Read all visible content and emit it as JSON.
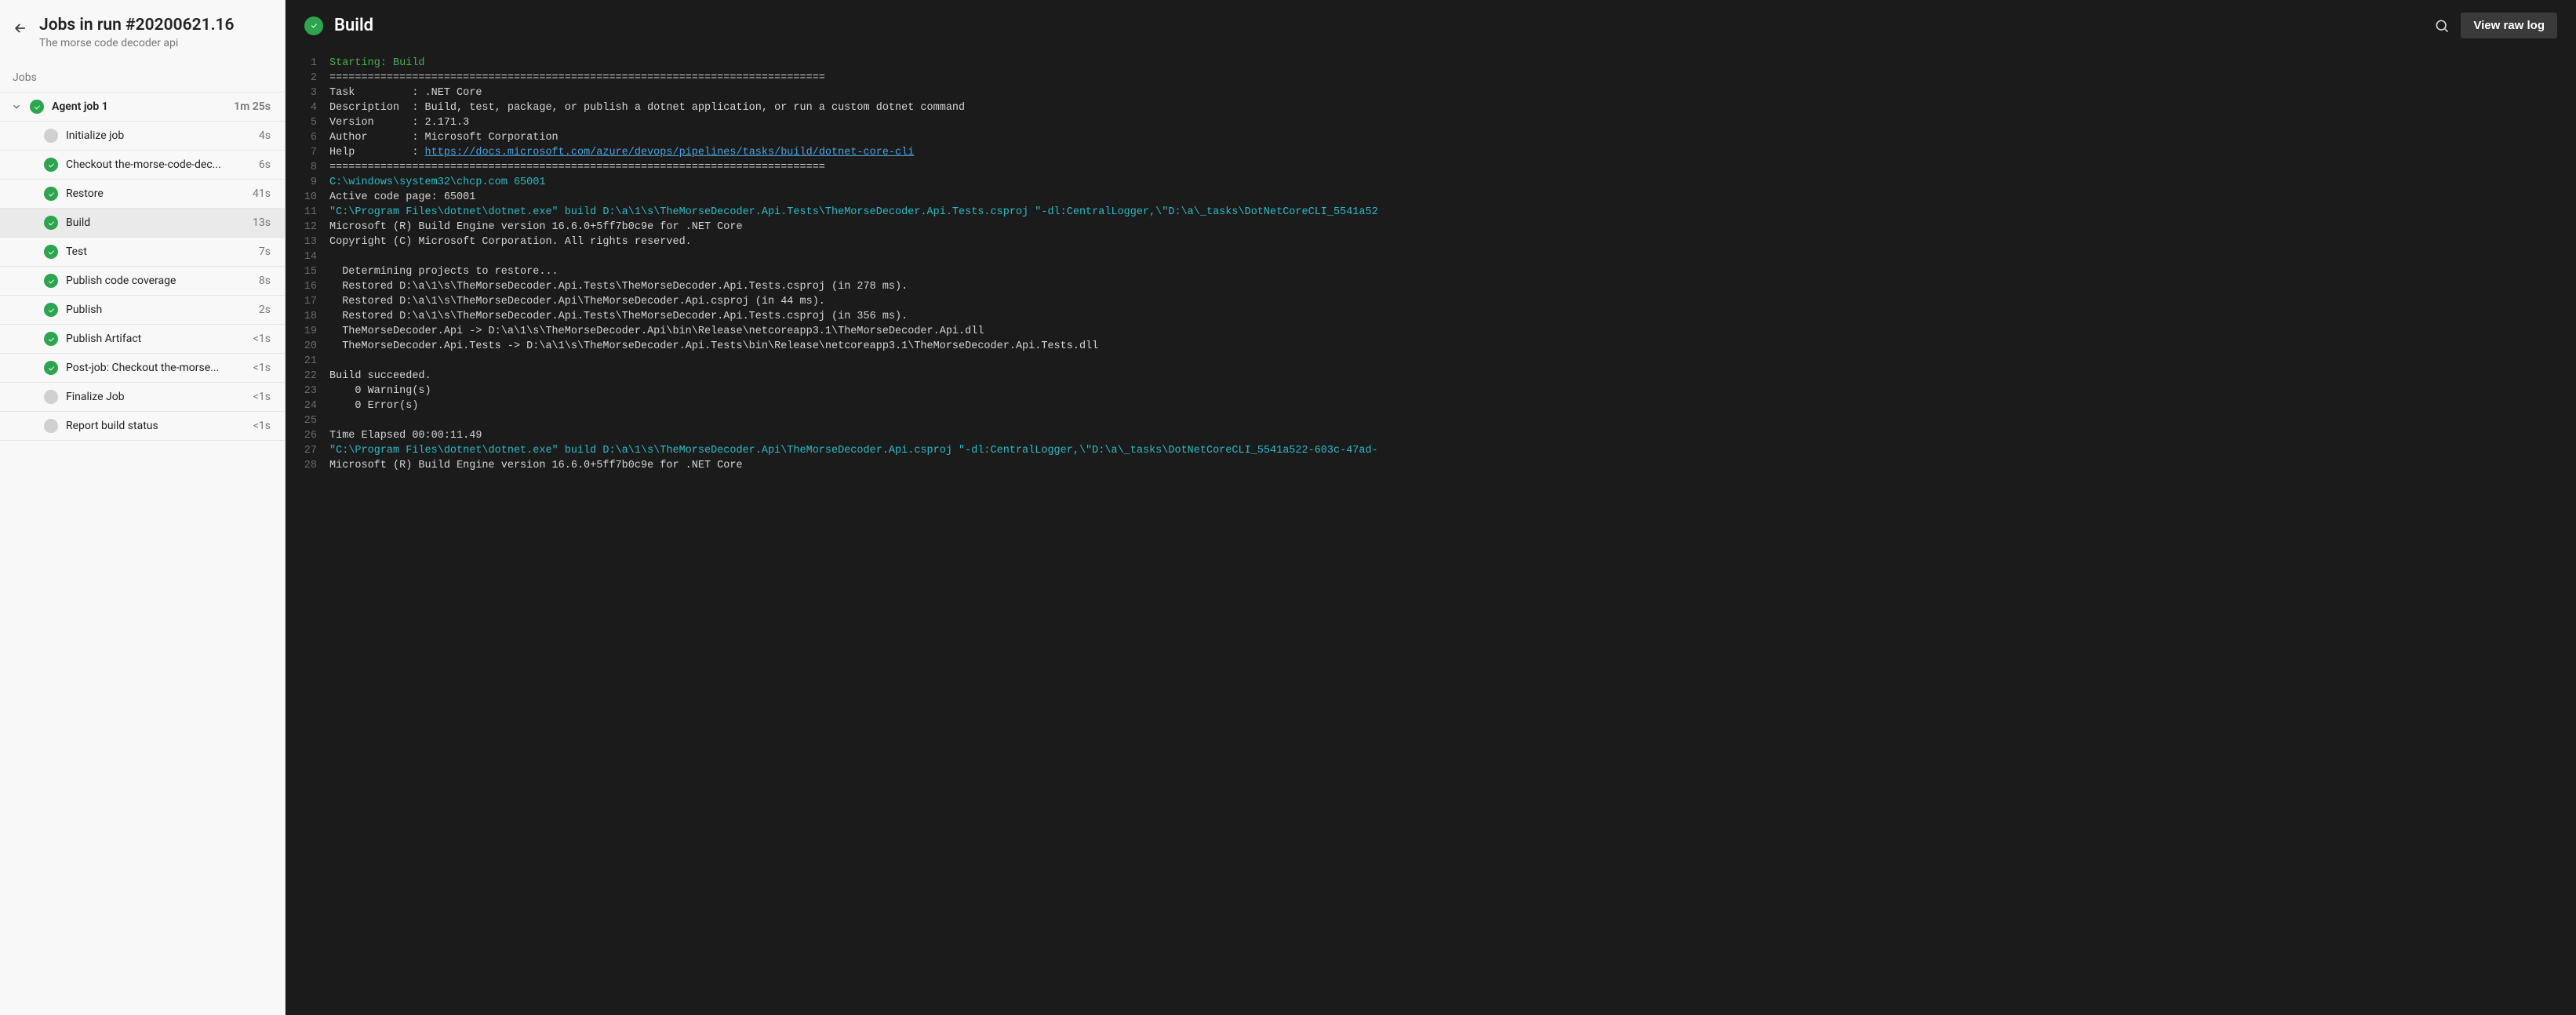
{
  "sidebar": {
    "title": "Jobs in run #20200621.16",
    "subtitle": "The morse code decoder api",
    "jobs_heading": "Jobs",
    "parent": {
      "label": "Agent job 1",
      "time": "1m 25s"
    },
    "steps": [
      {
        "label": "Initialize job",
        "time": "4s",
        "status": "neutral"
      },
      {
        "label": "Checkout the-morse-code-dec...",
        "time": "6s",
        "status": "success"
      },
      {
        "label": "Restore",
        "time": "41s",
        "status": "success"
      },
      {
        "label": "Build",
        "time": "13s",
        "status": "success",
        "selected": true
      },
      {
        "label": "Test",
        "time": "7s",
        "status": "success"
      },
      {
        "label": "Publish code coverage",
        "time": "8s",
        "status": "success"
      },
      {
        "label": "Publish",
        "time": "2s",
        "status": "success"
      },
      {
        "label": "Publish Artifact",
        "time": "<1s",
        "status": "success"
      },
      {
        "label": "Post-job: Checkout the-morse...",
        "time": "<1s",
        "status": "success"
      },
      {
        "label": "Finalize Job",
        "time": "<1s",
        "status": "neutral"
      },
      {
        "label": "Report build status",
        "time": "<1s",
        "status": "neutral"
      }
    ]
  },
  "header": {
    "title": "Build",
    "raw_log_button": "View raw log"
  },
  "log_lines": [
    {
      "n": 1,
      "cls": "c-green",
      "t": "Starting: Build"
    },
    {
      "n": 2,
      "t": "=============================================================================="
    },
    {
      "n": 3,
      "t": "Task         : .NET Core"
    },
    {
      "n": 4,
      "t": "Description  : Build, test, package, or publish a dotnet application, or run a custom dotnet command"
    },
    {
      "n": 5,
      "t": "Version      : 2.171.3"
    },
    {
      "n": 6,
      "t": "Author       : Microsoft Corporation"
    },
    {
      "n": 7,
      "t": "Help         : ",
      "link": "https://docs.microsoft.com/azure/devops/pipelines/tasks/build/dotnet-core-cli"
    },
    {
      "n": 8,
      "t": "=============================================================================="
    },
    {
      "n": 9,
      "cls": "c-cyan",
      "t": "C:\\windows\\system32\\chcp.com 65001"
    },
    {
      "n": 10,
      "t": "Active code page: 65001"
    },
    {
      "n": 11,
      "cls": "c-cyan",
      "t": "\"C:\\Program Files\\dotnet\\dotnet.exe\" build D:\\a\\1\\s\\TheMorseDecoder.Api.Tests\\TheMorseDecoder.Api.Tests.csproj \"-dl:CentralLogger,\\\"D:\\a\\_tasks\\DotNetCoreCLI_5541a52"
    },
    {
      "n": 12,
      "t": "Microsoft (R) Build Engine version 16.6.0+5ff7b0c9e for .NET Core"
    },
    {
      "n": 13,
      "t": "Copyright (C) Microsoft Corporation. All rights reserved."
    },
    {
      "n": 14,
      "t": ""
    },
    {
      "n": 15,
      "t": "  Determining projects to restore..."
    },
    {
      "n": 16,
      "t": "  Restored D:\\a\\1\\s\\TheMorseDecoder.Api.Tests\\TheMorseDecoder.Api.Tests.csproj (in 278 ms)."
    },
    {
      "n": 17,
      "t": "  Restored D:\\a\\1\\s\\TheMorseDecoder.Api\\TheMorseDecoder.Api.csproj (in 44 ms)."
    },
    {
      "n": 18,
      "t": "  Restored D:\\a\\1\\s\\TheMorseDecoder.Api.Tests\\TheMorseDecoder.Api.Tests.csproj (in 356 ms)."
    },
    {
      "n": 19,
      "t": "  TheMorseDecoder.Api -> D:\\a\\1\\s\\TheMorseDecoder.Api\\bin\\Release\\netcoreapp3.1\\TheMorseDecoder.Api.dll"
    },
    {
      "n": 20,
      "t": "  TheMorseDecoder.Api.Tests -> D:\\a\\1\\s\\TheMorseDecoder.Api.Tests\\bin\\Release\\netcoreapp3.1\\TheMorseDecoder.Api.Tests.dll"
    },
    {
      "n": 21,
      "t": ""
    },
    {
      "n": 22,
      "t": "Build succeeded."
    },
    {
      "n": 23,
      "t": "    0 Warning(s)"
    },
    {
      "n": 24,
      "t": "    0 Error(s)"
    },
    {
      "n": 25,
      "t": ""
    },
    {
      "n": 26,
      "t": "Time Elapsed 00:00:11.49"
    },
    {
      "n": 27,
      "cls": "c-cyan",
      "t": "\"C:\\Program Files\\dotnet\\dotnet.exe\" build D:\\a\\1\\s\\TheMorseDecoder.Api\\TheMorseDecoder.Api.csproj \"-dl:CentralLogger,\\\"D:\\a\\_tasks\\DotNetCoreCLI_5541a522-603c-47ad-"
    },
    {
      "n": 28,
      "t": "Microsoft (R) Build Engine version 16.6.0+5ff7b0c9e for .NET Core"
    }
  ]
}
